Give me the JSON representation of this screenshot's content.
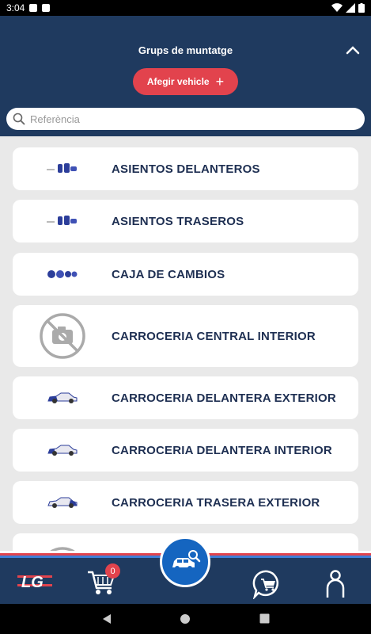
{
  "status_bar": {
    "time": "3:04"
  },
  "header": {
    "title": "Grups de muntatge",
    "add_button_label": "Afegir vehicle",
    "add_button_icon": "plus-icon",
    "collapse_icon": "chevron-up-icon"
  },
  "search": {
    "placeholder": "Referència",
    "value": ""
  },
  "categories": [
    {
      "label": "ASIENTOS DELANTEROS",
      "icon": "seats-icon"
    },
    {
      "label": "ASIENTOS TRASEROS",
      "icon": "seats-icon"
    },
    {
      "label": "CAJA DE CAMBIOS",
      "icon": "gearbox-icon"
    },
    {
      "label": "CARROCERIA CENTRAL INTERIOR",
      "icon": "no-photo-icon"
    },
    {
      "label": "CARROCERIA DELANTERA EXTERIOR",
      "icon": "car-icon"
    },
    {
      "label": "CARROCERIA DELANTERA INTERIOR",
      "icon": "car-icon"
    },
    {
      "label": "CARROCERIA TRASERA EXTERIOR",
      "icon": "car-icon"
    }
  ],
  "bottom_nav": {
    "logo_text": "LG",
    "cart_count": "0",
    "items": [
      "cart-icon",
      "car-search-icon",
      "chat-cart-icon",
      "user-icon"
    ]
  },
  "colors": {
    "header_bg": "#1f3a5f",
    "accent_red": "#e2434d",
    "fab_blue": "#1565c0",
    "label_navy": "#1e2f52"
  }
}
